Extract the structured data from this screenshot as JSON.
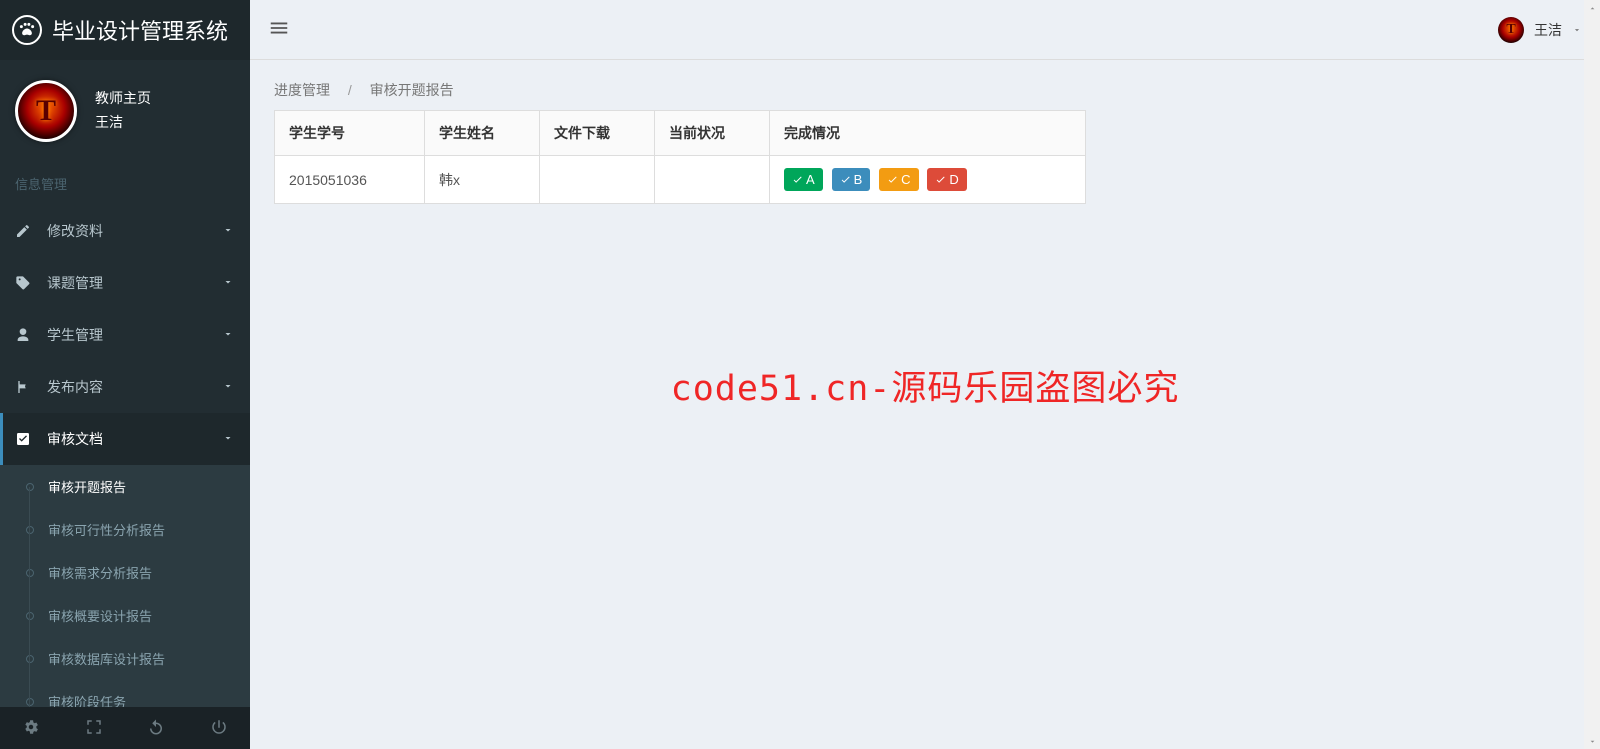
{
  "app": {
    "title": "毕业设计管理系统"
  },
  "user": {
    "role": "教师主页",
    "name": "王洁",
    "initial": "T"
  },
  "sidebar": {
    "section_label": "信息管理",
    "items": [
      {
        "label": "修改资料"
      },
      {
        "label": "课题管理"
      },
      {
        "label": "学生管理"
      },
      {
        "label": "发布内容"
      },
      {
        "label": "审核文档"
      }
    ],
    "submenu": [
      {
        "label": "审核开题报告"
      },
      {
        "label": "审核可行性分析报告"
      },
      {
        "label": "审核需求分析报告"
      },
      {
        "label": "审核概要设计报告"
      },
      {
        "label": "审核数据库设计报告"
      },
      {
        "label": "审核阶段任务"
      }
    ]
  },
  "breadcrumb": {
    "l1": "进度管理",
    "sep": "/",
    "l2": "审核开题报告"
  },
  "table": {
    "headers": {
      "c1": "学生学号",
      "c2": "学生姓名",
      "c3": "文件下载",
      "c4": "当前状况",
      "c5": "完成情况"
    },
    "rows": [
      {
        "id": "2015051036",
        "name": "韩x",
        "download": "",
        "status": "",
        "grades": {
          "a": "A",
          "b": "B",
          "c": "C",
          "d": "D"
        }
      }
    ]
  },
  "watermark": "code51.cn-源码乐园盗图必究",
  "topbar": {
    "username": "王洁",
    "initial": "T"
  }
}
